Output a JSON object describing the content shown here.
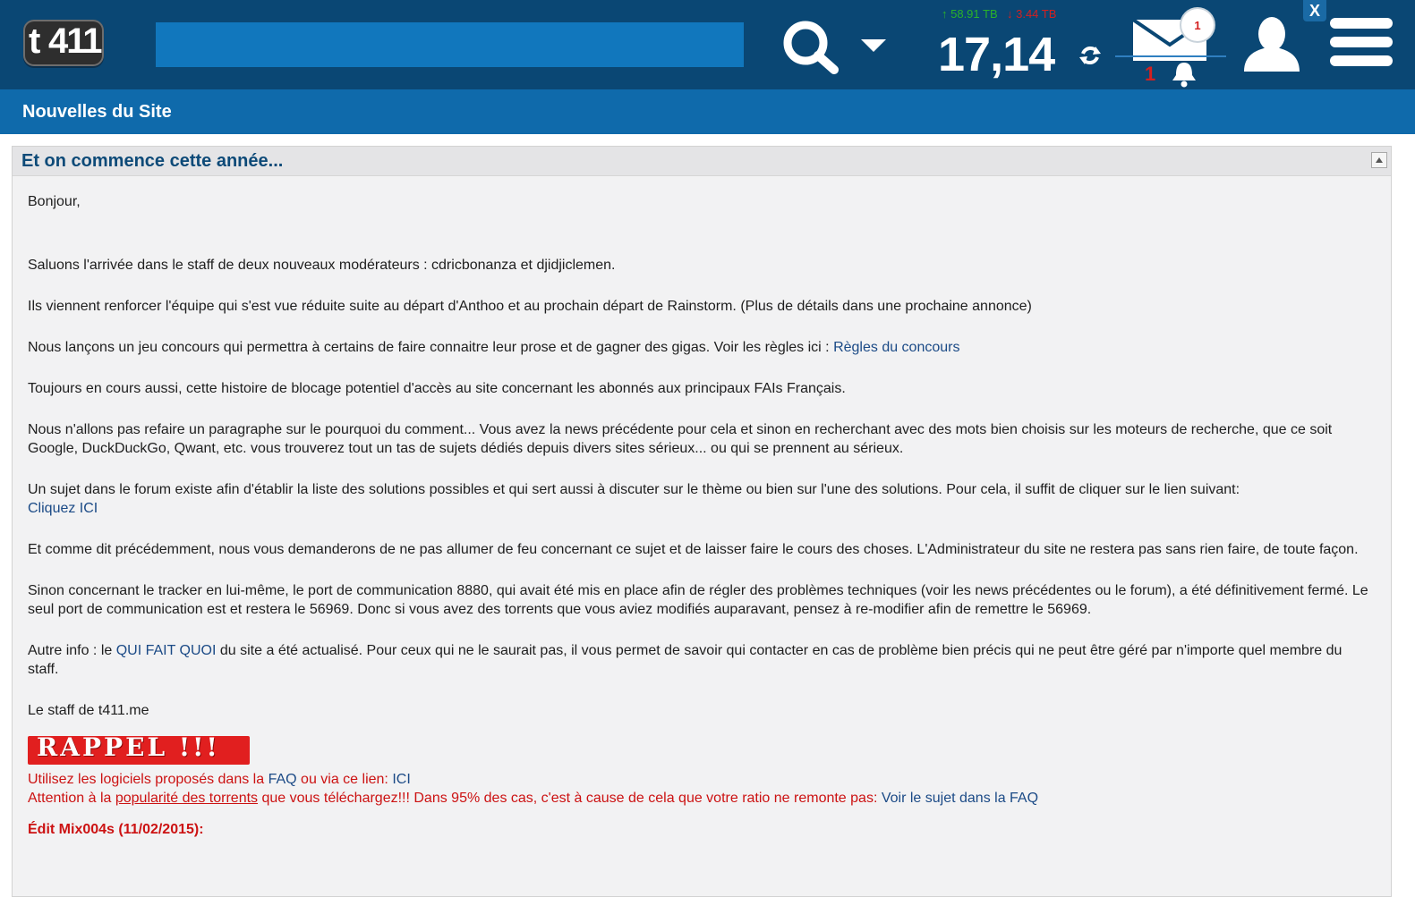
{
  "header": {
    "logo_t": "t",
    "logo_num": "411",
    "search_placeholder": "",
    "upload": "↑ 58.91 TB",
    "download": "↓ 3.44 TB",
    "ratio": "17,14",
    "mail_count": "1",
    "bell_count": "1",
    "close_label": "X"
  },
  "section": {
    "title": "Nouvelles du Site"
  },
  "news": {
    "title": "Et on commence cette année...",
    "greeting": "Bonjour,",
    "p1": "Saluons l'arrivée dans le staff de deux nouveaux modérateurs  : cdricbonanza et djidjiclemen.",
    "p2": "Ils viennent renforcer l'équipe qui s'est vue réduite suite au départ d'Anthoo et au prochain départ de Rainstorm. (Plus de détails dans une prochaine annonce)",
    "p3_text": "Nous lançons un jeu concours qui permettra à certains de faire connaitre leur prose et de gagner des gigas.  Voir les règles ici : ",
    "p3_link": "Règles du concours",
    "p4": "Toujours en cours aussi, cette histoire de blocage potentiel d'accès au site concernant les abonnés aux principaux FAIs Français.",
    "p5": "Nous n'allons pas refaire un paragraphe sur le pourquoi du comment... Vous avez la news précédente pour cela et sinon en recherchant avec des mots bien choisis sur les moteurs de recherche, que ce soit Google, DuckDuckGo, Qwant, etc. vous trouverez tout un tas de sujets dédiés depuis divers sites sérieux... ou qui se prennent au sérieux.",
    "p6_text": "Un sujet dans le forum existe afin d'établir la liste des solutions possibles et qui sert aussi à discuter sur le thème ou bien sur l'une des solutions. Pour cela, il suffit de cliquer sur le lien suivant:",
    "p6_link": "Cliquez ICI",
    "p7": "Et comme dit précédemment, nous vous demanderons de ne pas allumer de feu concernant ce sujet et de laisser faire le cours des choses. L'Administrateur du site ne restera pas sans rien faire, de toute façon.",
    "p8": "Sinon concernant le tracker en lui-même, le port de communication 8880, qui avait été mis en place afin de régler des problèmes techniques (voir les news précédentes ou le forum), a été définitivement fermé. Le seul port de communication est et restera le 56969. Donc si vous avez des torrents que vous aviez modifiés auparavant, pensez à re-modifier afin de remettre le 56969.",
    "p9_before": "Autre info : le ",
    "p9_link": "QUI FAIT QUOI",
    "p9_after": " du site a été actualisé. Pour ceux qui ne le saurait pas,  il vous permet de savoir qui contacter en cas de problème bien précis qui ne peut être géré par n'importe quel membre du staff.",
    "signature": "Le staff de t411.me",
    "rappel_label": "RAPPEL !!!",
    "r1_before": "Utilisez les logiciels proposés dans la ",
    "r1_faq": "FAQ",
    "r1_mid": " ou via ce lien: ",
    "r1_ici": "ICI",
    "r2_before": "Attention à la ",
    "r2_under": "popularité des torrents",
    "r2_mid": " que vous téléchargez!!! Dans 95% des cas, c'est à cause de cela que votre ratio ne remonte pas: ",
    "r2_link": "Voir le sujet dans la FAQ",
    "edit": "Édit Mix004s (11/02/2015):"
  }
}
